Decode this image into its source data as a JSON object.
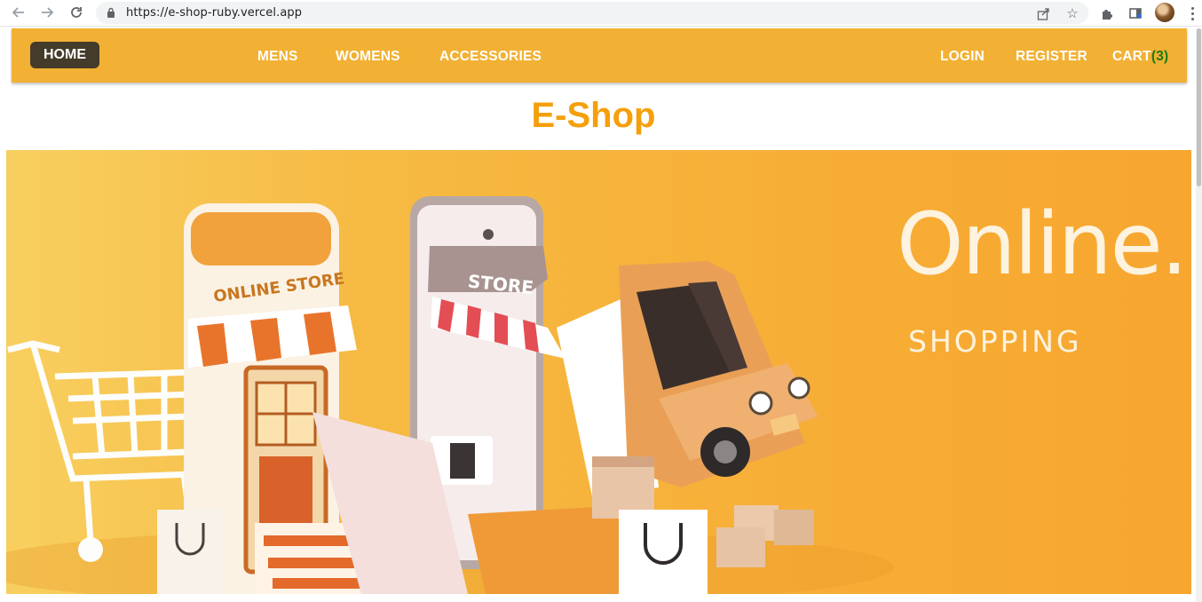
{
  "browser": {
    "url": "https://e-shop-ruby.vercel.app",
    "icons": [
      "back-icon",
      "forward-icon",
      "reload-icon",
      "lock-icon",
      "share-icon",
      "star-icon",
      "extensions-icon",
      "sidepanel-icon",
      "profile-avatar",
      "menu-icon"
    ]
  },
  "nav": {
    "home": "HOME",
    "mens": "MENS",
    "womens": "WOMENS",
    "accessories": "ACCESSORIES",
    "login": "LOGIN",
    "register": "REGISTER",
    "cart_label": "CART",
    "cart_count": "(3)"
  },
  "site_title": "E-Shop",
  "banner": {
    "headline": "Online.",
    "subline": "SHOPPING",
    "store_sign": "ONLINE STORE",
    "phone_sign": "STORE"
  },
  "colors": {
    "navbar": "#f2b134",
    "home_button": "#443b2a",
    "title": "#f59f0b",
    "cart_count": "#1c7a13",
    "banner": "#f6b03b"
  }
}
